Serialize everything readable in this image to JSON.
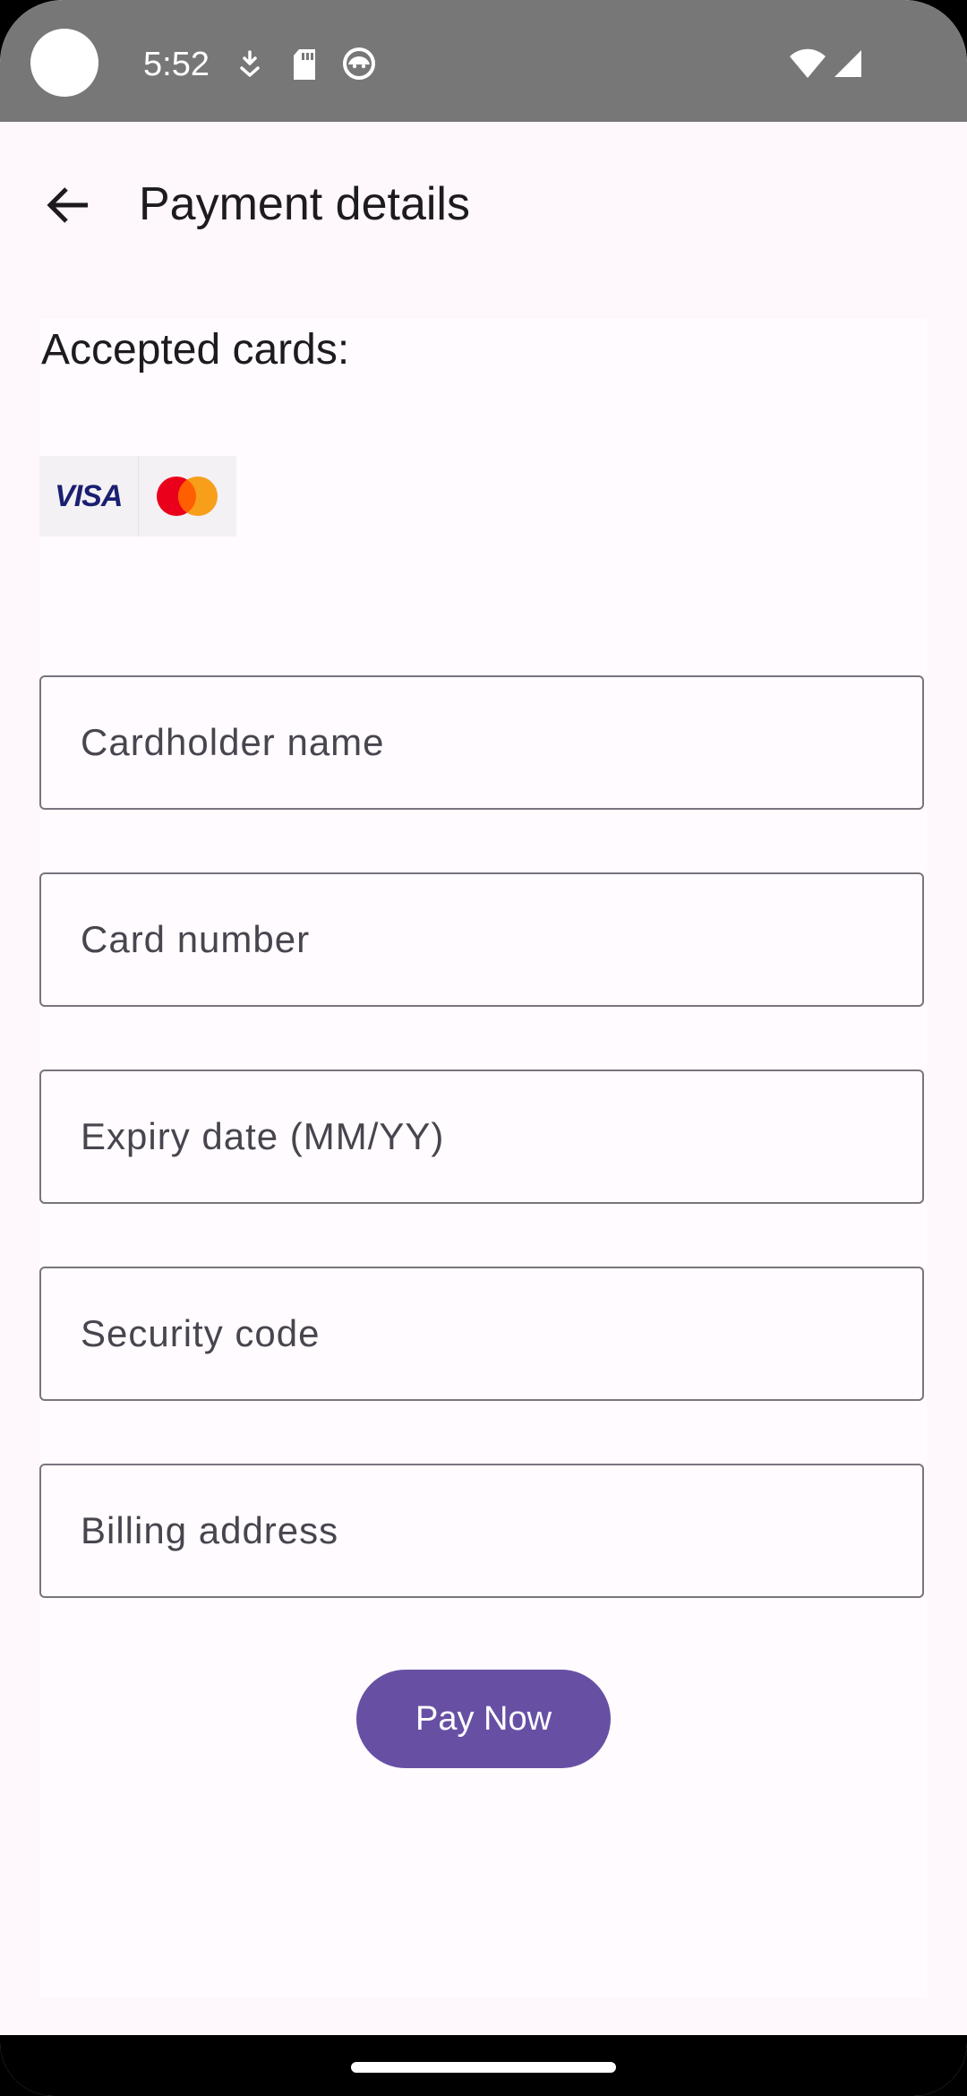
{
  "status_bar": {
    "time": "5:52",
    "icons": [
      "camera-icon",
      "download-icon",
      "sd-card-icon",
      "face-icon",
      "wifi-icon",
      "signal-icon"
    ]
  },
  "app_bar": {
    "back_icon": "arrow-back-icon",
    "title": "Payment details"
  },
  "accepted_cards": {
    "label": "Accepted cards:",
    "brands": [
      "visa",
      "mastercard"
    ],
    "visa_text": "VISA"
  },
  "form": {
    "cardholder_name": {
      "placeholder": "Cardholder name",
      "value": ""
    },
    "card_number": {
      "placeholder": "Card number",
      "value": ""
    },
    "expiry_date": {
      "placeholder": "Expiry date (MM/YY)",
      "value": ""
    },
    "security_code": {
      "placeholder": "Security code",
      "value": ""
    },
    "billing_address": {
      "placeholder": "Billing address",
      "value": ""
    }
  },
  "pay_button": {
    "label": "Pay Now"
  },
  "colors": {
    "primary": "#6750a4",
    "background": "#fef7fc",
    "status_bar": "#777777",
    "outline": "#79747e",
    "visa_blue": "#1a1f71",
    "mastercard_red": "#eb001b",
    "mastercard_orange": "#f79e1b"
  }
}
